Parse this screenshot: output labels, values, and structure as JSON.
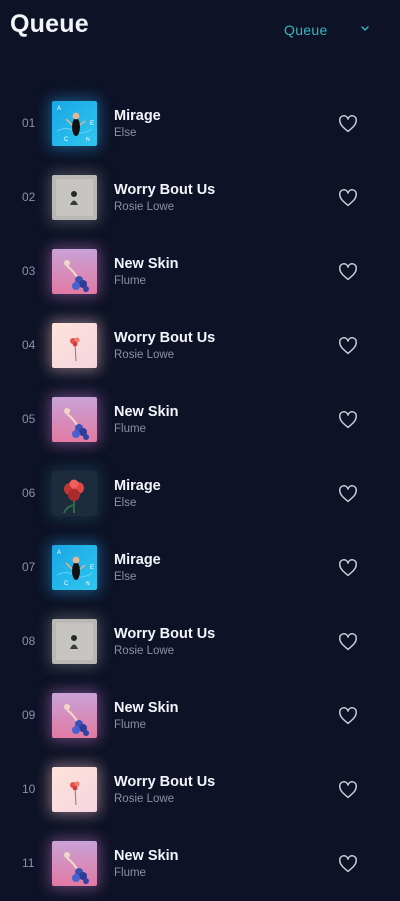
{
  "header": {
    "title": "Queue",
    "dropdown": {
      "selected": "Queue",
      "icon": "chevron-down-icon"
    }
  },
  "colors": {
    "background": "#0d1226",
    "accent": "#38b6c0",
    "secondary_text": "#8b90a6"
  },
  "tracks": [
    {
      "index": "01",
      "title": "Mirage",
      "artist": "Else",
      "art": "mirage-blue"
    },
    {
      "index": "02",
      "title": "Worry Bout Us",
      "artist": "Rosie Lowe",
      "art": "worry-grey"
    },
    {
      "index": "03",
      "title": "New Skin",
      "artist": "Flume",
      "art": "newskin-purple"
    },
    {
      "index": "04",
      "title": "Worry Bout Us",
      "artist": "Rosie Lowe",
      "art": "worry-peach"
    },
    {
      "index": "05",
      "title": "New Skin",
      "artist": "Flume",
      "art": "newskin-purple"
    },
    {
      "index": "06",
      "title": "Mirage",
      "artist": "Else",
      "art": "mirage-flower"
    },
    {
      "index": "07",
      "title": "Mirage",
      "artist": "Else",
      "art": "mirage-blue"
    },
    {
      "index": "08",
      "title": "Worry Bout Us",
      "artist": "Rosie Lowe",
      "art": "worry-grey"
    },
    {
      "index": "09",
      "title": "New Skin",
      "artist": "Flume",
      "art": "newskin-purple"
    },
    {
      "index": "10",
      "title": "Worry Bout Us",
      "artist": "Rosie Lowe",
      "art": "worry-peach"
    },
    {
      "index": "11",
      "title": "New Skin",
      "artist": "Flume",
      "art": "newskin-purple"
    }
  ],
  "row_icon": "heart-outline-icon"
}
